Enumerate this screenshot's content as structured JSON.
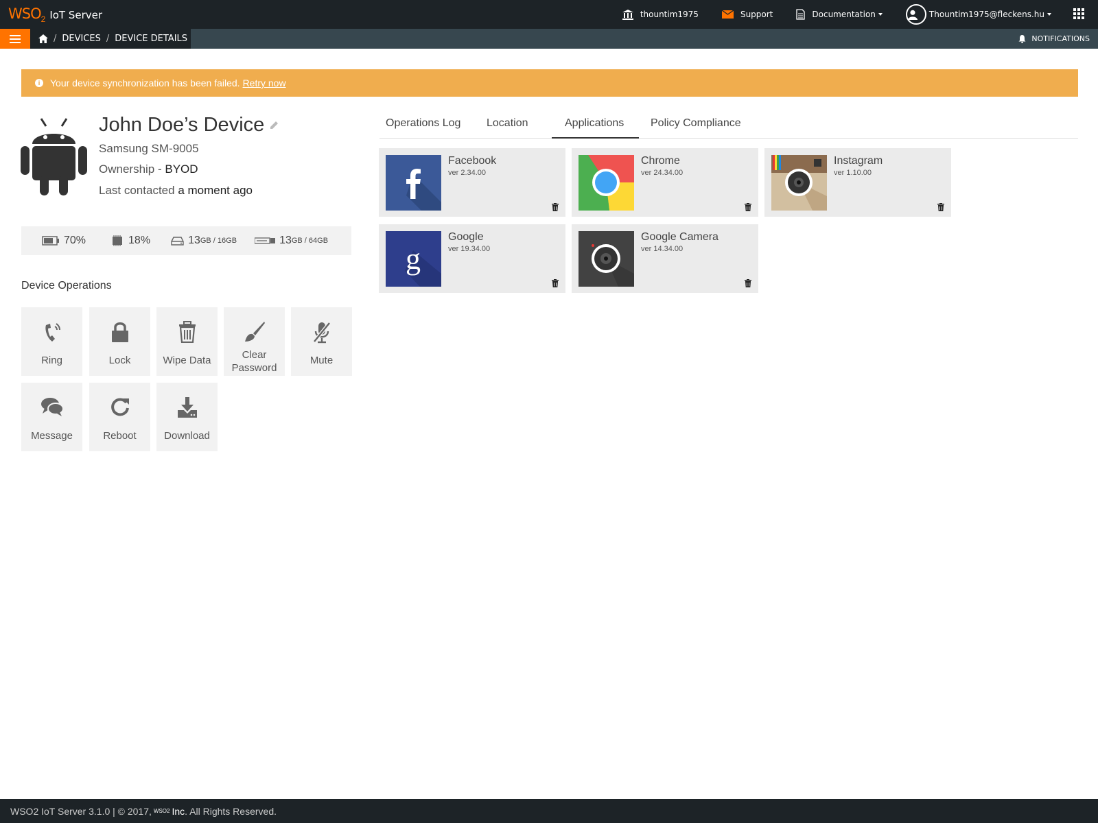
{
  "header": {
    "brand_wso": "WSO",
    "brand_two": "2",
    "brand_title": "IoT Server",
    "tenant": "thountim1975",
    "support": "Support",
    "documentation": "Documentation",
    "user": "Thountim1975@fleckens.hu"
  },
  "breadcrumb": {
    "devices": "DEVICES",
    "details": "DEVICE DETAILS",
    "separator": "/"
  },
  "notifications_label": "NOTIFICATIONS",
  "alert": {
    "message": "Your device synchronization has been failed.",
    "action": "Retry now"
  },
  "device": {
    "name": "John Doe’s Device",
    "model": "Samsung SM-9005",
    "ownership_label": "Ownership - ",
    "ownership": "BYOD",
    "contact_label": "Last contacted ",
    "contact": "a moment ago"
  },
  "stats": {
    "battery": "70%",
    "cpu": "18%",
    "storage_used": "13",
    "storage_total": "GB / 16GB",
    "external_used": "13",
    "external_total": "GB / 64GB"
  },
  "operations": {
    "title": "Device Operations",
    "items": [
      "Ring",
      "Lock",
      "Wipe Data",
      "Clear Password",
      "Mute",
      "Message",
      "Reboot",
      "Download"
    ]
  },
  "tabs": [
    "Operations Log",
    "Location",
    "Applications",
    "Policy Compliance"
  ],
  "active_tab": "Applications",
  "apps": [
    {
      "name": "Facebook",
      "version": "ver 2.34.00",
      "icon": "facebook-icon"
    },
    {
      "name": "Chrome",
      "version": "ver 24.34.00",
      "icon": "chrome-icon"
    },
    {
      "name": "Instagram",
      "version": "ver 1.10.00",
      "icon": "instagram-icon"
    },
    {
      "name": "Google",
      "version": "ver 19.34.00",
      "icon": "google-icon"
    },
    {
      "name": "Google Camera",
      "version": "ver 14.34.00",
      "icon": "camera-icon"
    }
  ],
  "footer": {
    "text": "WSO2 IoT Server 3.1.0 | © 2017,",
    "mini_logo": "WSO2",
    "inc": "Inc",
    "rights": ". All Rights Reserved."
  },
  "colors": {
    "accent": "#ff7300",
    "topbar": "#1d2327",
    "subbar": "#37474f",
    "alert": "#f0ad4e",
    "tile": "#f2f2f2",
    "card": "#ebebeb"
  }
}
